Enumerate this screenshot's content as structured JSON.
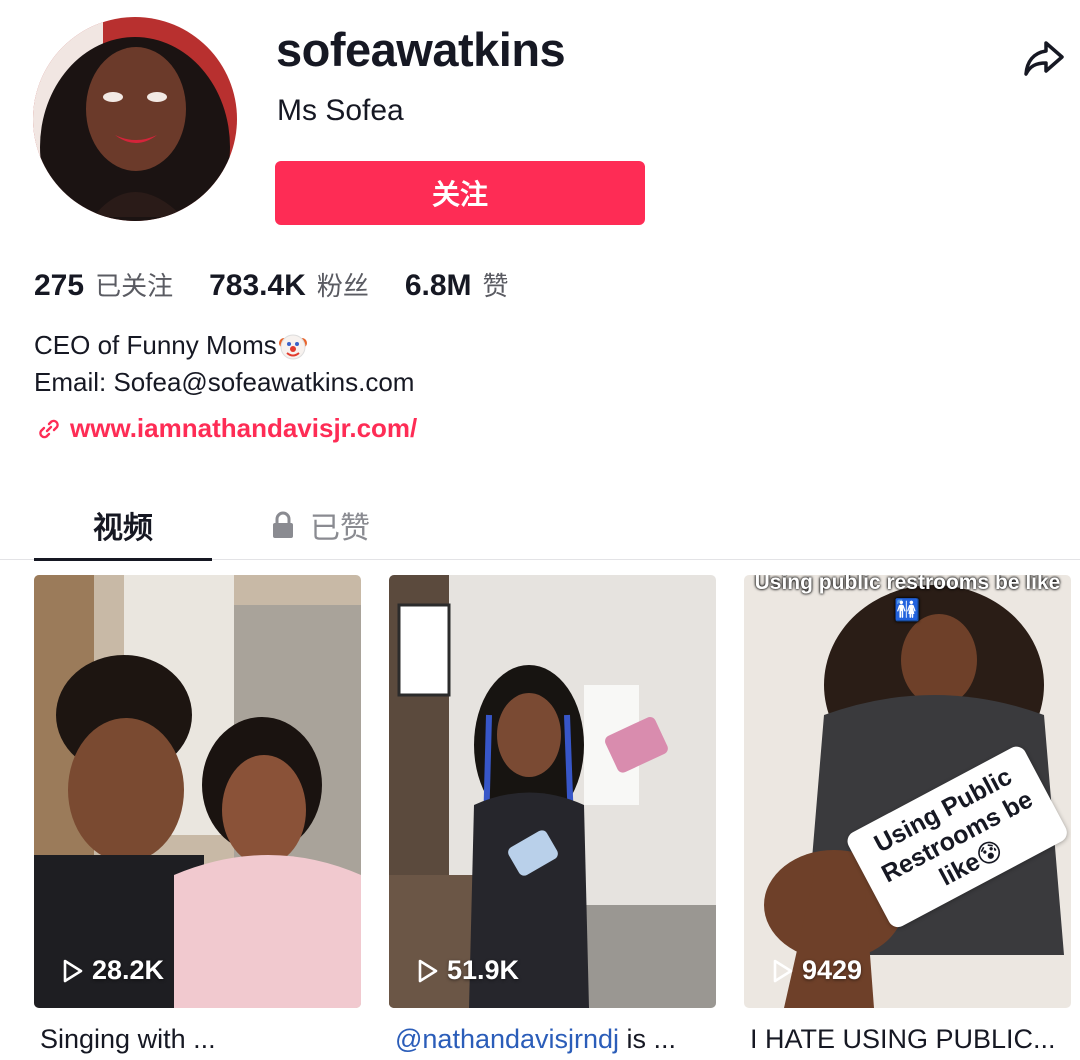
{
  "profile": {
    "username": "sofeawatkins",
    "nickname": "Ms Sofea",
    "follow_label": "关注",
    "avatar_icon": "profile-photo"
  },
  "stats": [
    {
      "value": "275",
      "label": "已关注"
    },
    {
      "value": "783.4K",
      "label": "粉丝"
    },
    {
      "value": "6.8M",
      "label": "赞"
    }
  ],
  "bio": {
    "line1": "CEO of Funny Moms",
    "line1_emoji": "clown-face",
    "line2": "Email: Sofea@sofeawatkins.com"
  },
  "link": {
    "text": "www.iamnathandavisjr.com/",
    "icon": "link-icon"
  },
  "tabs": [
    {
      "label": "视频",
      "active": true
    },
    {
      "label": "已赞",
      "locked": true
    }
  ],
  "videos": [
    {
      "views": "28.2K",
      "caption": "Singing with ...",
      "mention": ""
    },
    {
      "views": "51.9K",
      "caption": " is ...",
      "mention": "@nathandavisjrndj"
    },
    {
      "views": "9429",
      "caption": "I HATE USING PUBLIC...",
      "mention": "",
      "overlay_top": "Using public restrooms be like🚻",
      "sticker": "Using Public Restrooms be like😰"
    }
  ],
  "colors": {
    "accent": "#fe2c55",
    "text": "#161823",
    "secondary": "#5a5b62",
    "mention": "#2b5db9"
  }
}
